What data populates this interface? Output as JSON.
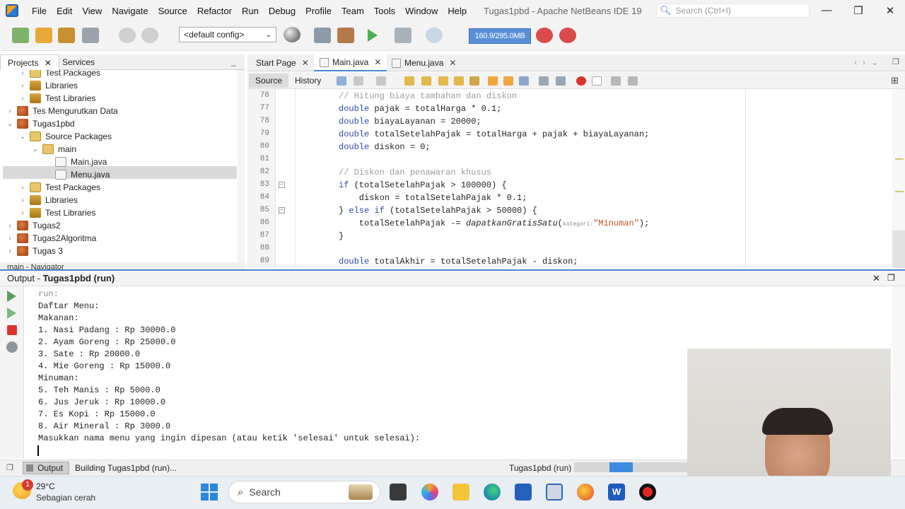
{
  "menu": [
    "File",
    "Edit",
    "View",
    "Navigate",
    "Source",
    "Refactor",
    "Run",
    "Debug",
    "Profile",
    "Team",
    "Tools",
    "Window",
    "Help"
  ],
  "window_title": "Tugas1pbd - Apache NetBeans IDE 19",
  "search_placeholder": "Search (Ctrl+I)",
  "toolbar": {
    "config": "<default config>",
    "memory": "160.9/295.0MB"
  },
  "projects_tabs": {
    "projects": "Projects",
    "services": "Services"
  },
  "tree": [
    {
      "label": "Test Packages",
      "depth": 1,
      "icon": "package",
      "twisty": "›"
    },
    {
      "label": "Libraries",
      "depth": 1,
      "icon": "library",
      "twisty": "›"
    },
    {
      "label": "Test Libraries",
      "depth": 1,
      "icon": "library",
      "twisty": "›"
    },
    {
      "label": "Tes Mengurutkan Data",
      "depth": 0,
      "icon": "project",
      "twisty": "›"
    },
    {
      "label": "Tugas1pbd",
      "depth": 0,
      "icon": "project",
      "twisty": "⌄"
    },
    {
      "label": "Source Packages",
      "depth": 1,
      "icon": "package",
      "twisty": "⌄"
    },
    {
      "label": "main",
      "depth": 2,
      "icon": "package",
      "twisty": "⌄"
    },
    {
      "label": "Main.java",
      "depth": 3,
      "icon": "java",
      "twisty": ""
    },
    {
      "label": "Menu.java",
      "depth": 3,
      "icon": "java",
      "twisty": "",
      "selected": true
    },
    {
      "label": "Test Packages",
      "depth": 1,
      "icon": "package",
      "twisty": "›"
    },
    {
      "label": "Libraries",
      "depth": 1,
      "icon": "library",
      "twisty": "›"
    },
    {
      "label": "Test Libraries",
      "depth": 1,
      "icon": "library",
      "twisty": "›"
    },
    {
      "label": "Tugas2",
      "depth": 0,
      "icon": "project",
      "twisty": "›"
    },
    {
      "label": "Tugas2Algoritma",
      "depth": 0,
      "icon": "project",
      "twisty": "›"
    },
    {
      "label": "Tugas 3",
      "depth": 0,
      "icon": "project",
      "twisty": "›"
    }
  ],
  "navigator_label": "main - Navigator",
  "editor_tabs": [
    "Start Page",
    "Main.java",
    "Menu.java"
  ],
  "editor_modes": {
    "source": "Source",
    "history": "History"
  },
  "code_lines": [
    {
      "n": "76",
      "html": "<span class='cm'>// Hitung biaya tambahan dan diskon</span>"
    },
    {
      "n": "77",
      "html": "<span class='kw'>double</span> pajak = totalHarga * 0.1;"
    },
    {
      "n": "78",
      "html": "<span class='kw'>double</span> biayaLayanan = 20000;"
    },
    {
      "n": "79",
      "html": "<span class='kw'>double</span> totalSetelahPajak = totalHarga + pajak + biayaLayanan;"
    },
    {
      "n": "80",
      "html": "<span class='kw'>double</span> diskon = 0;"
    },
    {
      "n": "81",
      "html": ""
    },
    {
      "n": "82",
      "html": "<span class='cm'>// Diskon dan penawaran khusus</span>"
    },
    {
      "n": "83",
      "html": "<span class='kw'>if</span> (totalSetelahPajak > 100000) {"
    },
    {
      "n": "84",
      "html": "    diskon = totalSetelahPajak * 0.1;"
    },
    {
      "n": "85",
      "html": "} <span class='kw'>else if</span> (totalSetelahPajak > 50000) {"
    },
    {
      "n": "86",
      "html": "    totalSetelahPajak -= <span class='fn'>dapatkanGratisSatu</span>(<span class='hint'>kategori:</span><span class='st'>\"Minuman\"</span>);"
    },
    {
      "n": "87",
      "html": "}"
    },
    {
      "n": "88",
      "html": ""
    },
    {
      "n": "89",
      "html": "<span class='kw'>double</span> totalAkhir = totalSetelahPajak - diskon;"
    }
  ],
  "output_title_prefix": "Output - ",
  "output_title_bold": "Tugas1pbd (run)",
  "output_lines": [
    "run:",
    "Daftar Menu:",
    "Makanan:",
    "1. Nasi Padang : Rp 30000.0",
    "2. Ayam Goreng : Rp 25000.0",
    "3. Sate : Rp 20000.0",
    "4. Mie Goreng : Rp 15000.0",
    "Minuman:",
    "5. Teh Manis : Rp 5000.0",
    "6. Jus Jeruk : Rp 10000.0",
    "7. Es Kopi : Rp 15000.0",
    "8. Air Mineral : Rp 3000.0",
    "Masukkan nama menu yang ingin dipesan (atau ketik 'selesai' untuk selesai):"
  ],
  "status": {
    "output_tab": "Output",
    "building": "Building Tugas1pbd (run)...",
    "running": "Tugas1pbd (run)"
  },
  "taskbar": {
    "weather_temp": "29°C",
    "weather_desc": "Sebagian cerah",
    "weather_badge": "1",
    "search": "Search"
  }
}
